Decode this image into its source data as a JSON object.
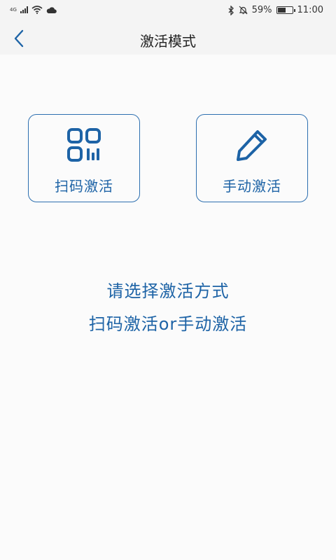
{
  "status_bar": {
    "network_label": "4G",
    "battery_percent": "59%",
    "battery_level": 0.59,
    "time": "11:00"
  },
  "header": {
    "title": "激活模式"
  },
  "options": {
    "scan_label": "扫码激活",
    "manual_label": "手动激活"
  },
  "hint": {
    "line1": "请选择激活方式",
    "line2": "扫码激活or手动激活"
  },
  "colors": {
    "accent": "#1d63a6",
    "card_border": "#2d6fb0"
  }
}
